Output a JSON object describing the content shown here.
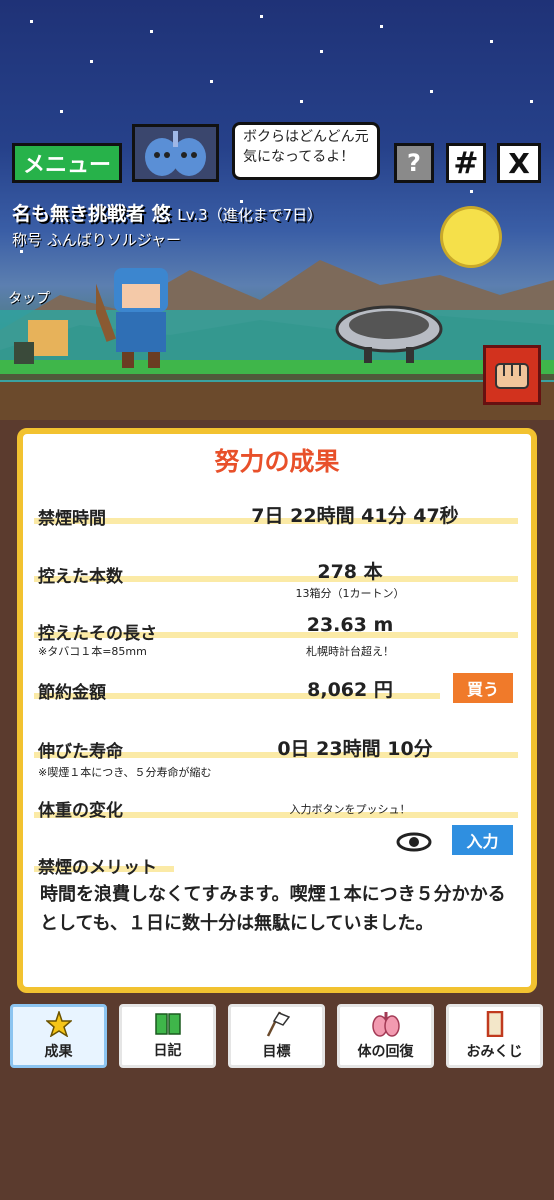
{
  "header": {
    "menu_label": "メニュー",
    "bubble_line1": "ボクらはどんどん元",
    "bubble_line2": "気になってるよ！",
    "help_label": "?",
    "hash_label": "#",
    "x_label": "X"
  },
  "player": {
    "name": "名も無き挑戦者 悠",
    "level": "Lv.3（進化まで7日）",
    "title": "称号 ふんばりソルジャー",
    "tap_label": "タップ"
  },
  "result": {
    "title": "努力の成果",
    "quit_time_label": "禁煙時間",
    "quit_time_value": "7日 22時間 41分 47秒",
    "skipped_count_label": "控えた本数",
    "skipped_count_value": "278 本",
    "skipped_count_sub": "13箱分（1カートン）",
    "length_label": "控えたその長さ",
    "length_note": "※タバコ１本=85mm",
    "length_value": "23.63 m",
    "length_sub": "札幌時計台超え！",
    "money_label": "節約金額",
    "money_value": "8,062 円",
    "buy_label": "買う",
    "life_label": "伸びた寿命",
    "life_note": "※喫煙１本につき、５分寿命が縮む",
    "life_value": "0日 23時間 10分",
    "weight_label": "体重の変化",
    "weight_hint": "入力ボタンをプッシュ！",
    "input_label": "入力",
    "merit_label": "禁煙のメリット",
    "merit_text": "時間を浪費しなくてすみます。喫煙１本につき５分かかるとしても、１日に数十分は無駄にしていました。"
  },
  "tabs": [
    {
      "label": "成果",
      "icon": "star-icon",
      "active": true
    },
    {
      "label": "日記",
      "icon": "book-icon",
      "active": false
    },
    {
      "label": "目標",
      "icon": "flag-icon",
      "active": false
    },
    {
      "label": "体の回復",
      "icon": "lungs-icon",
      "active": false
    },
    {
      "label": "おみくじ",
      "icon": "omikuji-icon",
      "active": false
    }
  ],
  "colors": {
    "card_border": "#f2c230",
    "title_orange": "#e8502a",
    "menu_green": "#27b24a",
    "buy_orange": "#f07a2a",
    "input_blue": "#2f8fe0"
  }
}
